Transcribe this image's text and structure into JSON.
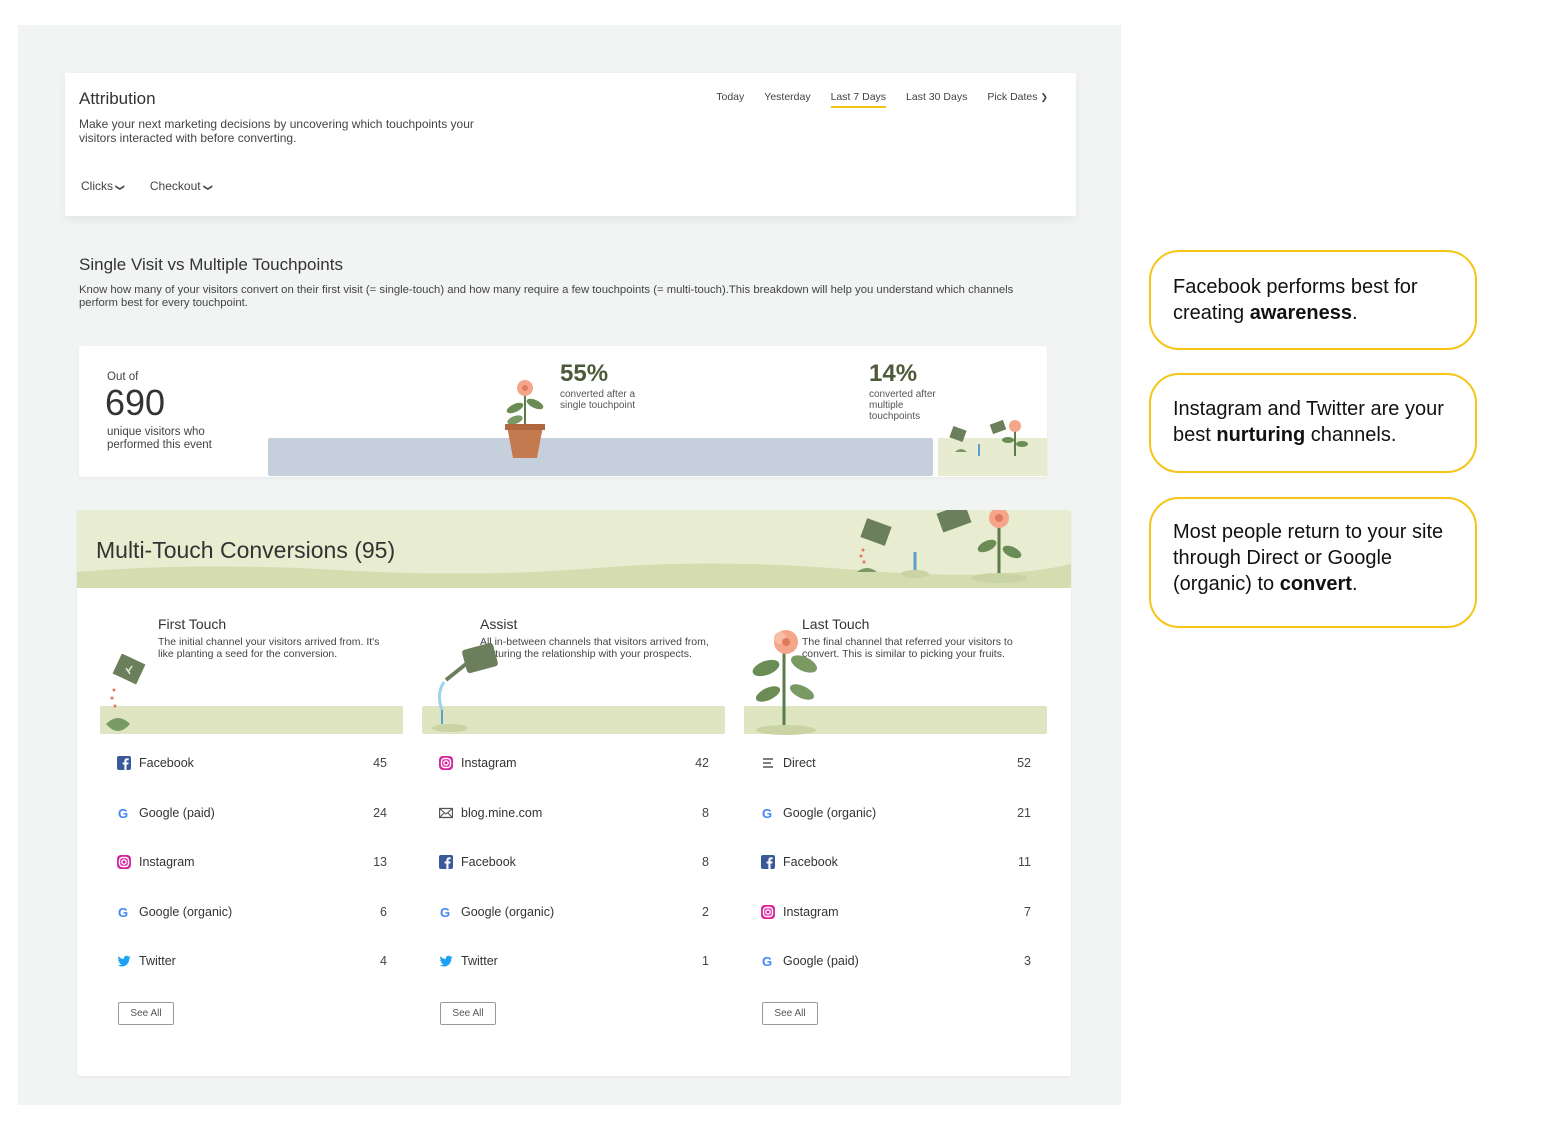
{
  "header": {
    "title": "Attribution",
    "subtitle": "Make your next marketing decisions by uncovering which touchpoints your visitors interacted with before converting.",
    "date_ranges": [
      "Today",
      "Yesterday",
      "Last 7 Days",
      "Last 30 Days"
    ],
    "active_range": "Last 7 Days",
    "pick_dates": "Pick Dates",
    "filter_metric": "Clicks",
    "filter_event": "Checkout"
  },
  "single_visit": {
    "title": "Single Visit vs Multiple Touchpoints",
    "description": "Know how many of your visitors convert on their first visit (= single-touch) and how many require a few touchpoints (= multi-touch).This breakdown will help you understand which channels perform best for every touchpoint.",
    "out_of_label": "Out of",
    "visitors": "690",
    "visitors_desc": "unique visitors who performed this event",
    "single_pct": "55%",
    "single_desc": "converted after a single touchpoint",
    "multi_pct": "14%",
    "multi_desc": "converted after multiple touchpoints"
  },
  "multi_touch": {
    "title": "Multi-Touch Conversions (95)",
    "see_all": "See All",
    "columns": [
      {
        "title": "First Touch",
        "description": "The initial channel your visitors arrived from. It's like planting a seed for the conversion.",
        "rows": [
          {
            "name": "Facebook",
            "value": "45",
            "icon": "facebook-icon"
          },
          {
            "name": "Google (paid)",
            "value": "24",
            "icon": "google-icon"
          },
          {
            "name": "Instagram",
            "value": "13",
            "icon": "instagram-icon"
          },
          {
            "name": "Google (organic)",
            "value": "6",
            "icon": "google-icon"
          },
          {
            "name": "Twitter",
            "value": "4",
            "icon": "twitter-icon"
          }
        ]
      },
      {
        "title": "Assist",
        "description": "All in-between channels that visitors arrived from, nurturing the relationship with your prospects.",
        "rows": [
          {
            "name": "Instagram",
            "value": "42",
            "icon": "instagram-icon"
          },
          {
            "name": "blog.mine.com",
            "value": "8",
            "icon": "email-icon"
          },
          {
            "name": "Facebook",
            "value": "8",
            "icon": "facebook-icon"
          },
          {
            "name": "Google (organic)",
            "value": "2",
            "icon": "google-icon"
          },
          {
            "name": "Twitter",
            "value": "1",
            "icon": "twitter-icon"
          }
        ]
      },
      {
        "title": "Last Touch",
        "description": "The final channel that referred your visitors to convert. This is similar to picking your fruits.",
        "rows": [
          {
            "name": "Direct",
            "value": "52",
            "icon": "direct-icon"
          },
          {
            "name": "Google (organic)",
            "value": "21",
            "icon": "google-icon"
          },
          {
            "name": "Facebook",
            "value": "11",
            "icon": "facebook-icon"
          },
          {
            "name": "Instagram",
            "value": "7",
            "icon": "instagram-icon"
          },
          {
            "name": "Google (paid)",
            "value": "3",
            "icon": "google-icon"
          }
        ]
      }
    ]
  },
  "callouts": [
    {
      "before": "Facebook performs best for creating ",
      "bold": "awareness",
      "after": "."
    },
    {
      "before": "Instagram and Twitter are your best ",
      "bold": "nurturing",
      "after": " channels."
    },
    {
      "before": "Most people return to your site through Direct or Google (organic) to ",
      "bold": "convert",
      "after": "."
    }
  ],
  "colors": {
    "accent": "#f5c518",
    "page_bg": "#f1f4f3",
    "single_bar": "#c6d0dd",
    "banner": "#e8ecd0",
    "facebook": "#3b5998",
    "twitter": "#1da1f2"
  }
}
